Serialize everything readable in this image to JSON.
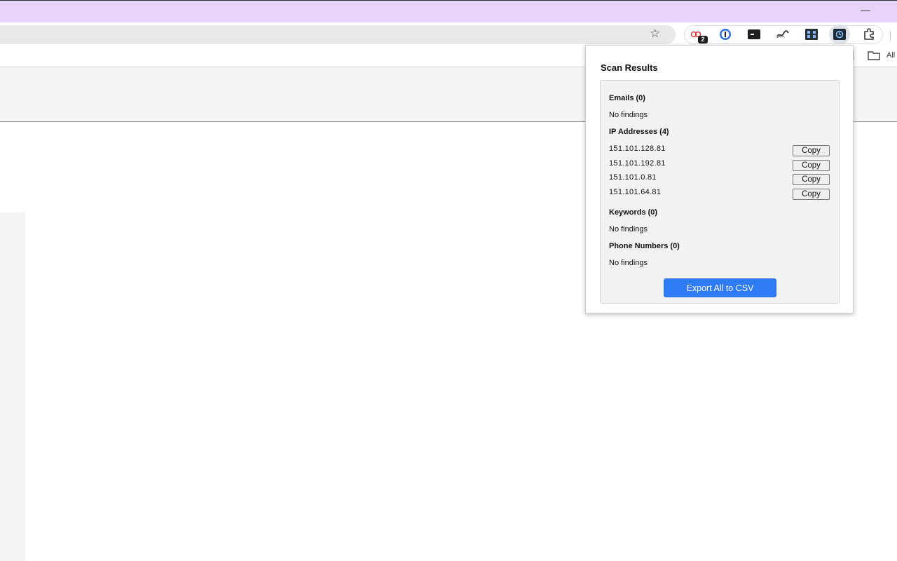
{
  "window": {
    "minimize_glyph": "—"
  },
  "toolbar": {
    "star_glyph": "☆",
    "extensions": [
      {
        "name": "lastpass-extension",
        "badge": "2"
      },
      {
        "name": "onepassword-extension"
      },
      {
        "name": "terminal-extension"
      },
      {
        "name": "wave-extension"
      },
      {
        "name": "grid-extension"
      },
      {
        "name": "scanner-extension",
        "active": true
      },
      {
        "name": "extensions-puzzle"
      }
    ]
  },
  "bookmarks": {
    "folder_label": "All"
  },
  "popup": {
    "title": "Scan Results",
    "sections": {
      "emails": {
        "title": "Emails (0)",
        "empty_text": "No findings"
      },
      "ips": {
        "title": "IP Addresses (4)",
        "items": [
          {
            "value": "151.101.128.81",
            "button": "Copy"
          },
          {
            "value": "151.101.192.81",
            "button": "Copy"
          },
          {
            "value": "151.101.0.81",
            "button": "Copy"
          },
          {
            "value": "151.101.64.81",
            "button": "Copy"
          }
        ]
      },
      "keywords": {
        "title": "Keywords (0)",
        "empty_text": "No findings"
      },
      "phones": {
        "title": "Phone Numbers (0)",
        "empty_text": "No findings"
      }
    },
    "export_label": "Export All to CSV"
  },
  "colors": {
    "titlebar": "#e6d3f7",
    "export_button": "#2f7bf5"
  }
}
